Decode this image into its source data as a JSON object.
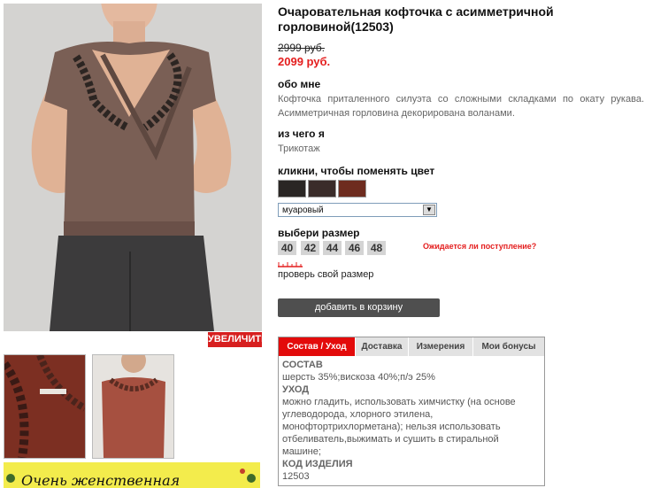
{
  "product": {
    "title": "Очаровательная кофточка с асимметричной горловиной(12503)",
    "old_price": "2999 руб.",
    "new_price": "2099 руб."
  },
  "about": {
    "heading": "обо мне",
    "text": "Кофточка приталенного силуэта со сложными складками по окату рукава. Асимметричная горловина декорирована воланами."
  },
  "material": {
    "heading": "из чего я",
    "text": "Трикотаж"
  },
  "colors": {
    "heading": "кликни, чтобы поменять цвет",
    "swatches": [
      {
        "name": "dark-black",
        "color": "#2a2624"
      },
      {
        "name": "dark-mixed",
        "color": "#3a2c2a"
      },
      {
        "name": "brick-red",
        "color": "#6e2c1f"
      }
    ],
    "selected": "муаровый"
  },
  "sizes": {
    "heading": "выбери размер",
    "options": [
      "40",
      "42",
      "44",
      "46",
      "48"
    ],
    "expected_link": "Ожидается ли поступление?",
    "check_size": "проверь свой размер"
  },
  "cart": {
    "button": "добавить в корзину"
  },
  "gallery": {
    "zoom_button": "УВЕЛИЧИТЬ"
  },
  "banner": {
    "text": "Очень женственная"
  },
  "tabs": {
    "items": [
      "Состав / Уход",
      "Доставка",
      "Измерения",
      "Мои бонусы"
    ],
    "active": "Состав / Уход",
    "content": {
      "composition_heading": "СОСТАВ",
      "composition": "шерсть 35%;вискоза 40%;п/э 25%",
      "care_heading": "УХОД",
      "care": "можно гладить, использовать химчистку (на основе углеводорода, хлорного этилена, монофтортрихлорметана); нельзя использовать отбеливатель,выжимать и сушить в стиральной машине;",
      "code_heading": "КОД ИЗДЕЛИЯ",
      "code": "12503"
    }
  },
  "accent_colors": {
    "price_red": "#e41e1e",
    "tab_red": "#e30b0b",
    "button_dark": "#4f4f4f",
    "banner_yellow": "#f3ec4c"
  }
}
